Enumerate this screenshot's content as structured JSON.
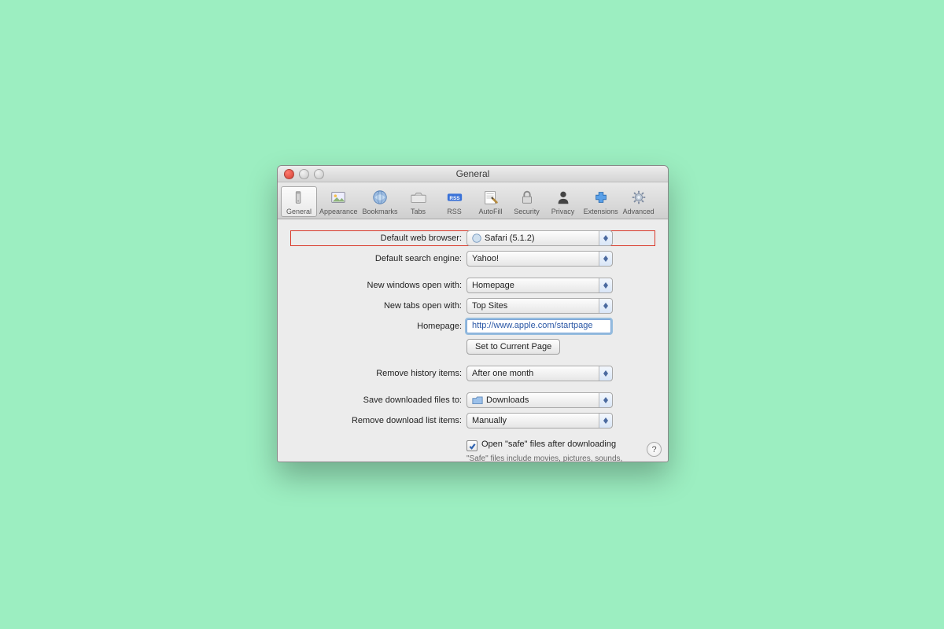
{
  "window": {
    "title": "General"
  },
  "toolbar": {
    "items": [
      {
        "id": "general",
        "label": "General",
        "selected": true
      },
      {
        "id": "appearance",
        "label": "Appearance",
        "selected": false
      },
      {
        "id": "bookmarks",
        "label": "Bookmarks",
        "selected": false
      },
      {
        "id": "tabs",
        "label": "Tabs",
        "selected": false
      },
      {
        "id": "rss",
        "label": "RSS",
        "selected": false
      },
      {
        "id": "autofill",
        "label": "AutoFill",
        "selected": false
      },
      {
        "id": "security",
        "label": "Security",
        "selected": false
      },
      {
        "id": "privacy",
        "label": "Privacy",
        "selected": false
      },
      {
        "id": "extensions",
        "label": "Extensions",
        "selected": false
      },
      {
        "id": "advanced",
        "label": "Advanced",
        "selected": false
      }
    ]
  },
  "form": {
    "default_browser_label": "Default web browser:",
    "default_browser_value": "Safari (5.1.2)",
    "default_search_label": "Default search engine:",
    "default_search_value": "Yahoo!",
    "new_windows_label": "New windows open with:",
    "new_windows_value": "Homepage",
    "new_tabs_label": "New tabs open with:",
    "new_tabs_value": "Top Sites",
    "homepage_label": "Homepage:",
    "homepage_value": "http://www.apple.com/startpage",
    "set_current_page_label": "Set to Current Page",
    "remove_history_label": "Remove history items:",
    "remove_history_value": "After one month",
    "save_downloads_label": "Save downloaded files to:",
    "save_downloads_value": "Downloads",
    "remove_downloads_label": "Remove download list items:",
    "remove_downloads_value": "Manually",
    "open_safe_label": "Open \"safe\" files after downloading",
    "open_safe_checked": true,
    "open_safe_hint": "\"Safe\" files include movies, pictures, sounds, PDF and text documents, and archives."
  },
  "help_glyph": "?"
}
